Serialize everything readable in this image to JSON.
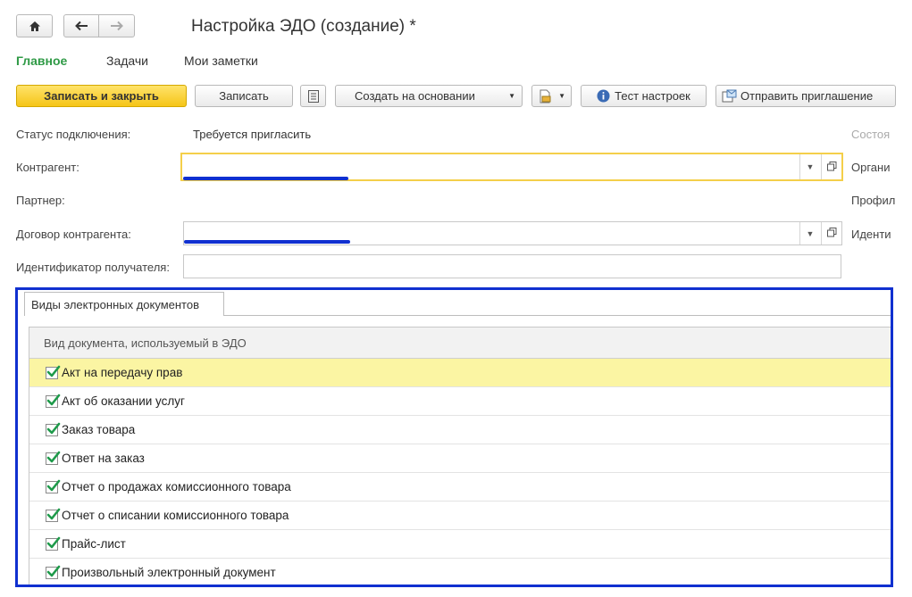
{
  "header": {
    "title": "Настройка ЭДО (создание) *",
    "home_icon": "home-icon",
    "back_icon": "arrow-left-icon",
    "forward_icon": "arrow-right-icon"
  },
  "nav": {
    "items": [
      {
        "label": "Главное",
        "active": true
      },
      {
        "label": "Задачи",
        "active": false
      },
      {
        "label": "Мои заметки",
        "active": false
      }
    ]
  },
  "toolbar": {
    "save_close": "Записать и закрыть",
    "save": "Записать",
    "create_based": "Создать на основании",
    "test": "Тест настроек",
    "send_invite": "Отправить приглашение"
  },
  "form": {
    "status_label": "Статус подключения:",
    "status_value": "Требуется пригласить",
    "counterparty_label": "Контрагент:",
    "counterparty_value": "",
    "partner_label": "Партнер:",
    "contract_label": "Договор контрагента:",
    "contract_value": "",
    "recipient_id_label": "Идентификатор получателя:",
    "recipient_id_value": "",
    "right_labels": [
      "Состоя",
      "Органи",
      "Профил",
      "Иденти"
    ]
  },
  "doc_panel": {
    "tab": "Виды электронных документов",
    "column_header": "Вид документа, используемый в ЭДО",
    "rows": [
      {
        "label": "Акт на передачу прав",
        "checked": true,
        "selected": true
      },
      {
        "label": "Акт об оказании услуг",
        "checked": true,
        "selected": false
      },
      {
        "label": "Заказ товара",
        "checked": true,
        "selected": false
      },
      {
        "label": "Ответ на заказ",
        "checked": true,
        "selected": false
      },
      {
        "label": "Отчет о продажах комиссионного товара",
        "checked": true,
        "selected": false
      },
      {
        "label": "Отчет о списании комиссионного товара",
        "checked": true,
        "selected": false
      },
      {
        "label": "Прайс-лист",
        "checked": true,
        "selected": false
      },
      {
        "label": "Произвольный электронный документ",
        "checked": true,
        "selected": false
      }
    ]
  },
  "colors": {
    "accent_nav": "#2f9a46",
    "primary_button": "#f5c518",
    "highlight_border": "#1030d0",
    "selected_row": "#fbf5a3"
  }
}
